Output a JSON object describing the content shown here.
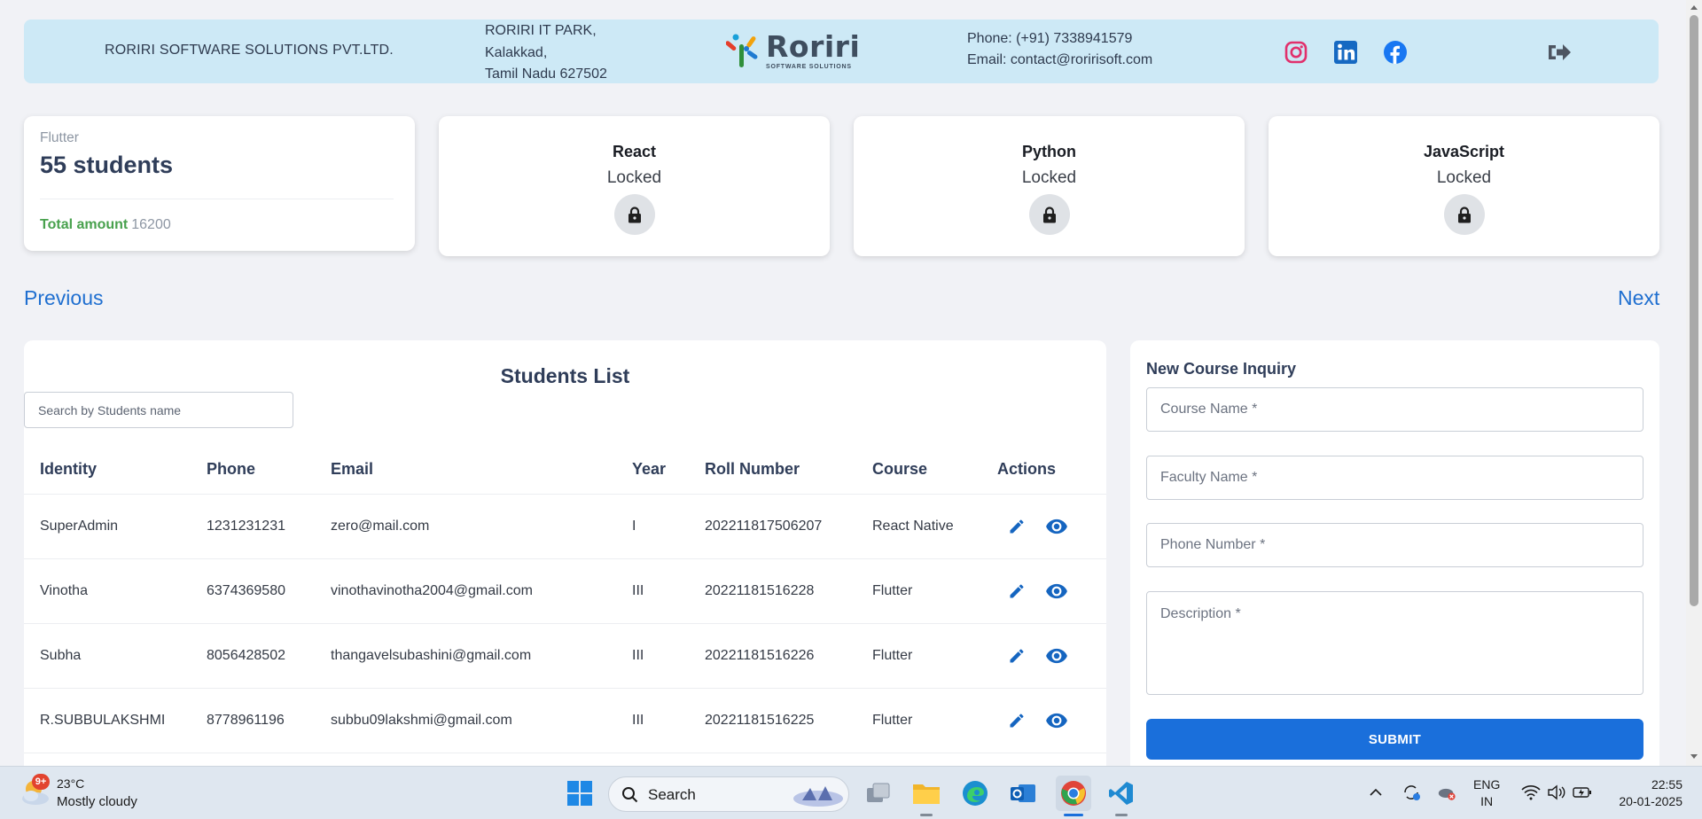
{
  "header": {
    "company": "RORIRI SOFTWARE SOLUTIONS PVT.LTD.",
    "address_line1": "RORIRI IT PARK,",
    "address_line2": "Kalakkad,",
    "address_line3": "Tamil Nadu 627502",
    "logo_word": "Roriri",
    "logo_sub": "SOFTWARE SOLUTIONS",
    "phone": "Phone: (+91) 7338941579",
    "email": "Email: contact@roririsoft.com",
    "social_icons": [
      "instagram-icon",
      "linkedin-icon",
      "facebook-icon"
    ],
    "logout_icon": "logout-icon"
  },
  "stats_card": {
    "course": "Flutter",
    "count": "55 students",
    "total_label": "Total amount",
    "total_value": "16200"
  },
  "locked_courses": [
    {
      "title": "React",
      "status": "Locked"
    },
    {
      "title": "Python",
      "status": "Locked"
    },
    {
      "title": "JavaScript",
      "status": "Locked"
    }
  ],
  "nav": {
    "previous": "Previous",
    "next": "Next"
  },
  "students": {
    "title": "Students List",
    "search_placeholder": "Search by Students name",
    "columns": [
      "Identity",
      "Phone",
      "Email",
      "Year",
      "Roll Number",
      "Course",
      "Actions"
    ],
    "rows": [
      {
        "identity": "SuperAdmin",
        "phone": "1231231231",
        "email": "zero@mail.com",
        "year": "I",
        "roll": "202211817506207",
        "course": "React Native"
      },
      {
        "identity": "Vinotha",
        "phone": "6374369580",
        "email": "vinothavinotha2004@gmail.com",
        "year": "III",
        "roll": "20221181516228",
        "course": "Flutter"
      },
      {
        "identity": "Subha",
        "phone": "8056428502",
        "email": "thangavelsubashini@gmail.com",
        "year": "III",
        "roll": "20221181516226",
        "course": "Flutter"
      },
      {
        "identity": "R.SUBBULAKSHMI",
        "phone": "8778961196",
        "email": "subbu09lakshmi@gmail.com",
        "year": "III",
        "roll": "20221181516225",
        "course": "Flutter"
      }
    ],
    "action_icons": [
      "edit-icon",
      "view-icon"
    ]
  },
  "inquiry": {
    "title": "New Course Inquiry",
    "course_placeholder": "Course Name *",
    "faculty_placeholder": "Faculty Name *",
    "phone_placeholder": "Phone Number *",
    "description_placeholder": "Description *",
    "submit_label": "SUBMIT"
  },
  "taskbar": {
    "weather_badge": "9+",
    "temperature": "23°C",
    "condition": "Mostly cloudy",
    "search_label": "Search",
    "lang_line1": "ENG",
    "lang_line2": "IN",
    "time": "22:55",
    "date": "20-01-2025"
  },
  "colors": {
    "header_bg": "#cde9f6",
    "link_blue": "#1f6fd0",
    "submit_blue": "#1a6fdb",
    "total_green": "#48a14d"
  }
}
